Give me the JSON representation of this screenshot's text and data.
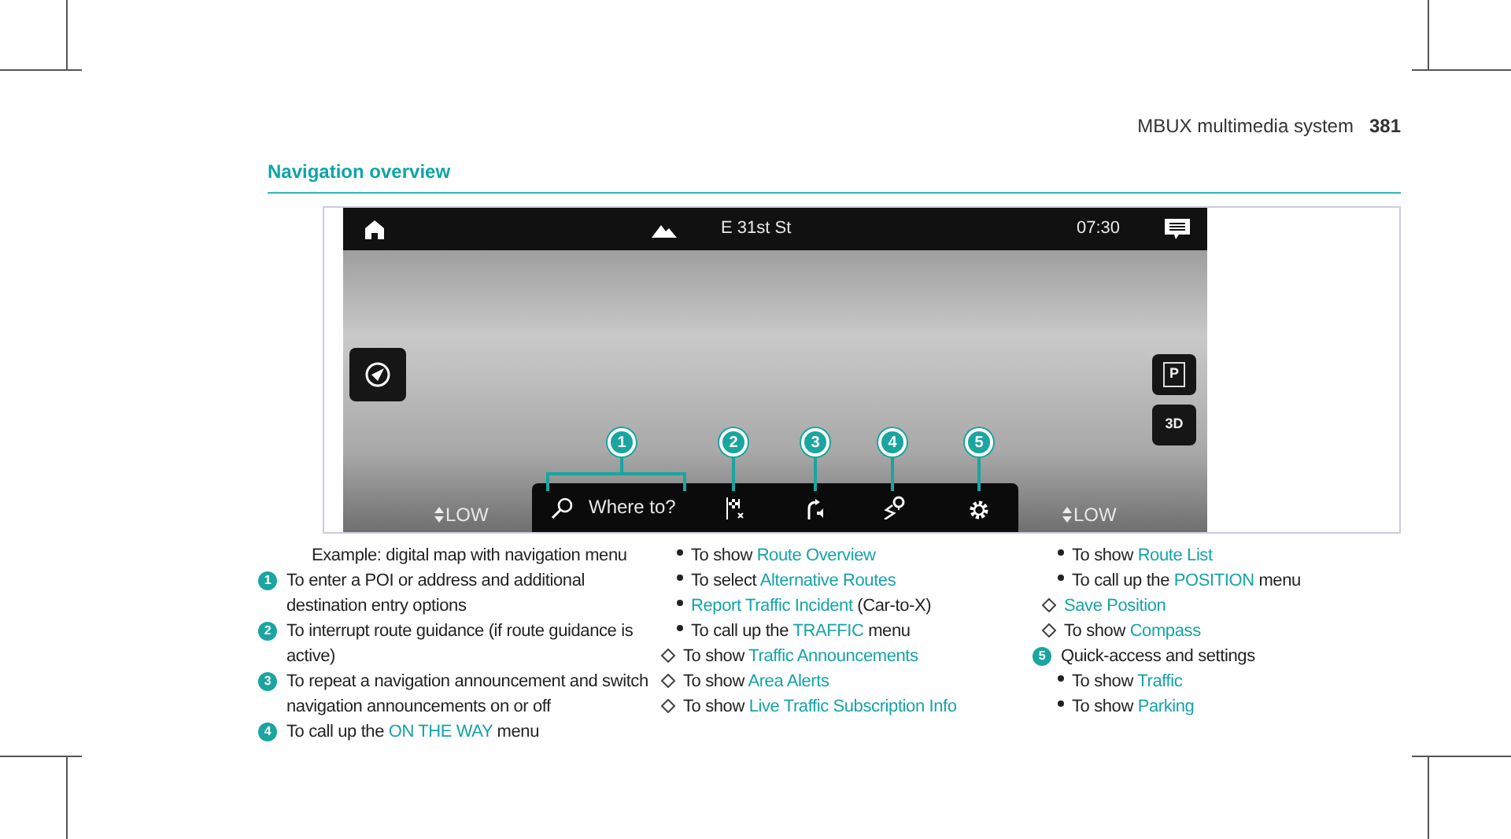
{
  "header": {
    "section": "MBUX multimedia system",
    "page": "381"
  },
  "title": "Navigation overview",
  "screen": {
    "street": "E 31st St",
    "time": "07:30",
    "search_label": "Where to?",
    "level_left": "LOW",
    "level_right": "LOW",
    "map_buttons": [
      "P",
      "3D"
    ]
  },
  "callouts": [
    "1",
    "2",
    "3",
    "4",
    "5"
  ],
  "caption": "Example: digital map with navigation menu",
  "columns": [
    [
      {
        "kind": "numbered",
        "number": "1",
        "parts": [
          {
            "text": "To enter a POI or address and additional destination entry options",
            "highlight": false
          }
        ]
      },
      {
        "kind": "numbered",
        "number": "2",
        "parts": [
          {
            "text": "To interrupt route guidance (if route guidance is active)",
            "highlight": false
          }
        ]
      },
      {
        "kind": "numbered",
        "number": "3",
        "parts": [
          {
            "text": "To repeat a navigation announcement and switch navigation announcements on or off",
            "highlight": false
          }
        ]
      },
      {
        "kind": "numbered",
        "number": "4",
        "parts": [
          {
            "text": "To call up the ",
            "highlight": false
          },
          {
            "text": "ON THE WAY",
            "highlight": true
          },
          {
            "text": " menu",
            "highlight": false
          }
        ]
      }
    ],
    [
      {
        "kind": "bullet",
        "parts": [
          {
            "text": "To show ",
            "highlight": false
          },
          {
            "text": "Route Overview",
            "highlight": true
          }
        ]
      },
      {
        "kind": "bullet",
        "parts": [
          {
            "text": "To select ",
            "highlight": false
          },
          {
            "text": "Alternative Routes",
            "highlight": true
          }
        ]
      },
      {
        "kind": "bullet",
        "parts": [
          {
            "text": "Report Traffic Incident",
            "highlight": true
          },
          {
            "text": " (Car-to-X)",
            "highlight": false
          }
        ]
      },
      {
        "kind": "bullet",
        "parts": [
          {
            "text": "To call up the ",
            "highlight": false
          },
          {
            "text": "TRAFFIC",
            "highlight": true
          },
          {
            "text": " menu",
            "highlight": false
          }
        ]
      },
      {
        "kind": "diamond",
        "parts": [
          {
            "text": "To show ",
            "highlight": false
          },
          {
            "text": "Traffic Announcements",
            "highlight": true
          }
        ]
      },
      {
        "kind": "diamond",
        "parts": [
          {
            "text": "To show ",
            "highlight": false
          },
          {
            "text": "Area Alerts",
            "highlight": true
          }
        ]
      },
      {
        "kind": "diamond",
        "parts": [
          {
            "text": "To show ",
            "highlight": false
          },
          {
            "text": "Live Traffic Subscription Info",
            "highlight": true
          }
        ]
      }
    ],
    [
      {
        "kind": "bullet",
        "parts": [
          {
            "text": "To show ",
            "highlight": false
          },
          {
            "text": "Route List",
            "highlight": true
          }
        ]
      },
      {
        "kind": "bullet",
        "parts": [
          {
            "text": "To call up the ",
            "highlight": false
          },
          {
            "text": "POSITION",
            "highlight": true
          },
          {
            "text": " menu",
            "highlight": false
          }
        ]
      },
      {
        "kind": "diamond",
        "parts": [
          {
            "text": "Save Position",
            "highlight": true
          }
        ]
      },
      {
        "kind": "diamond",
        "parts": [
          {
            "text": "To show ",
            "highlight": false
          },
          {
            "text": "Compass",
            "highlight": true
          }
        ]
      },
      {
        "kind": "numbered",
        "number": "5",
        "parts": [
          {
            "text": "Quick-access and settings",
            "highlight": false
          }
        ]
      },
      {
        "kind": "bullet",
        "parts": [
          {
            "text": "To show ",
            "highlight": false
          },
          {
            "text": "Traffic",
            "highlight": true
          }
        ]
      },
      {
        "kind": "bullet",
        "parts": [
          {
            "text": "To show ",
            "highlight": false
          },
          {
            "text": "Parking",
            "highlight": true
          }
        ]
      }
    ]
  ]
}
